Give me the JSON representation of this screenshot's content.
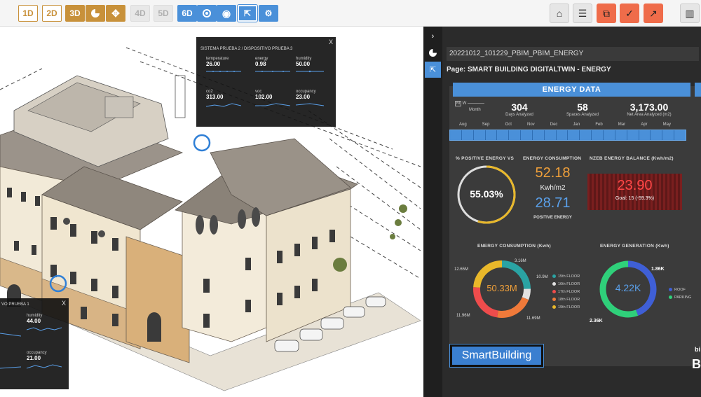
{
  "toolbar": {
    "buttons": [
      "1D",
      "2D",
      "3D",
      "4D",
      "5D",
      "6D"
    ],
    "colors": {
      "accent": "#c8913a",
      "blue": "#4a90d9",
      "red": "#ef6c4a"
    }
  },
  "popup_main": {
    "title": "SISTEMA PRUEBA 2 / DISPOSITIVO PRUEBA 3",
    "close": "X",
    "metrics": [
      {
        "label": "temperature",
        "value": "26.00"
      },
      {
        "label": "energy",
        "value": "0.98"
      },
      {
        "label": "humidity",
        "value": "50.00"
      },
      {
        "label": "co2",
        "value": "313.00"
      },
      {
        "label": "voc",
        "value": "102.00"
      },
      {
        "label": "occupancy",
        "value": "23.00"
      }
    ]
  },
  "popup_bottom": {
    "title": "VO PRUEBA 1",
    "close": "X",
    "metrics": [
      {
        "label": "humidity",
        "value": "44.00"
      },
      {
        "label": "occupancy",
        "value": "21.00"
      }
    ]
  },
  "dashboard": {
    "report": "20221012_101229_PBIM_PBIM_ENERGY",
    "page": "Page: SMART BUILDING DIGITALTWIN - ENERGY",
    "section_title": "ENERGY DATA",
    "period_toggle": {
      "m": "M",
      "w": "W",
      "month": "Month"
    },
    "stats": [
      {
        "value": "304",
        "label": "Days Analyzed"
      },
      {
        "value": "58",
        "label": "Spaces Analyzed"
      },
      {
        "value": "3,173.00",
        "label": "Net Area Analyzed (m2)"
      }
    ],
    "months": [
      "Aug",
      "Sep",
      "Oct",
      "Nov",
      "Dec",
      "Jan",
      "Feb",
      "Mar",
      "Apr",
      "May"
    ],
    "positive_title": "% POSITIVE ENERGY VS",
    "positive_pct": "55.03%",
    "consumption_title": "ENERGY CONSUMPTION",
    "consumption_value": "52.18",
    "consumption_unit": "Kwh/m2",
    "positive_value": "28.71",
    "positive_label": "POSITIVE ENERGY",
    "nzeb_title": "NZEB ENERGY BALANCE (Kwh/m2)",
    "nzeb_value": "23.90",
    "nzeb_goal": "Goal: 15 (-59.3%)",
    "cons_chart_title": "ENERGY CONSUMPTION (Kwh)",
    "cons_total": "50.33M",
    "cons_labels": {
      "a": "12.65M",
      "b": "3.16M",
      "c": "10.9M",
      "d": "11.96M",
      "e": "11.69M"
    },
    "cons_legend": [
      "15th FLOOR",
      "16th FLOOR",
      "17th FLOOR",
      "18th FLOOR",
      "19th FLOOR"
    ],
    "gen_chart_title": "ENERGY GENERATION (Kwh)",
    "gen_total": "4.22K",
    "gen_labels": {
      "a": "1.86K",
      "b": "2.36K"
    },
    "gen_legend": [
      "ROOF",
      "PARKING"
    ],
    "logo": "SmartBuilding",
    "brand_small": "bi",
    "brand_big": "B"
  }
}
